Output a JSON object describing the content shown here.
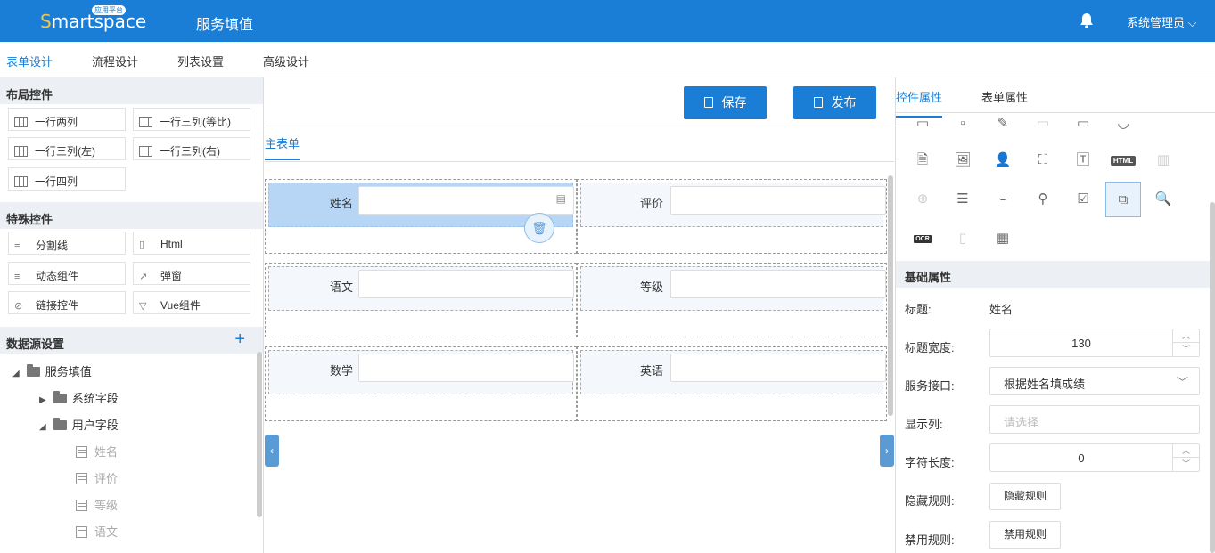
{
  "header": {
    "logo_text": "Smartspace",
    "logo_badge": "应用平台",
    "app_title": "服务填值",
    "user": "系统管理员",
    "accent": "#1a7ed6"
  },
  "main_tabs": [
    "表单设计",
    "流程设计",
    "列表设置",
    "高级设计"
  ],
  "left": {
    "layout_title": "布局控件",
    "layout_items": [
      "一行两列",
      "一行三列(等比)",
      "一行三列(左)",
      "一行三列(右)",
      "一行四列"
    ],
    "special_title": "特殊控件",
    "special_items": [
      "分割线",
      "Html",
      "动态组件",
      "弹窗",
      "链接控件",
      "Vue组件"
    ],
    "datasource_title": "数据源设置",
    "datasource_add": "+",
    "tree": {
      "root": "服务填值",
      "system": "系统字段",
      "user": "用户字段",
      "fields": [
        "姓名",
        "评价",
        "等级",
        "语文"
      ]
    }
  },
  "center": {
    "save": "保存",
    "publish": "发布",
    "subtab": "主表单",
    "fields": [
      "姓名",
      "评价",
      "语文",
      "等级",
      "数学",
      "英语"
    ]
  },
  "right": {
    "tabs": [
      "控件属性",
      "表单属性"
    ],
    "icon_html": "HTML",
    "icon_ocr": "OCR",
    "basic_title": "基础属性",
    "props": {
      "title_label": "标题:",
      "title_value": "姓名",
      "width_label": "标题宽度:",
      "width_value": "130",
      "service_label": "服务接口:",
      "service_value": "根据姓名填成绩",
      "display_label": "显示列:",
      "display_placeholder": "请选择",
      "length_label": "字符长度:",
      "length_value": "0",
      "hide_label": "隐藏规则:",
      "hide_btn": "隐藏规则",
      "disable_label": "禁用规则:",
      "disable_btn": "禁用规则"
    }
  }
}
